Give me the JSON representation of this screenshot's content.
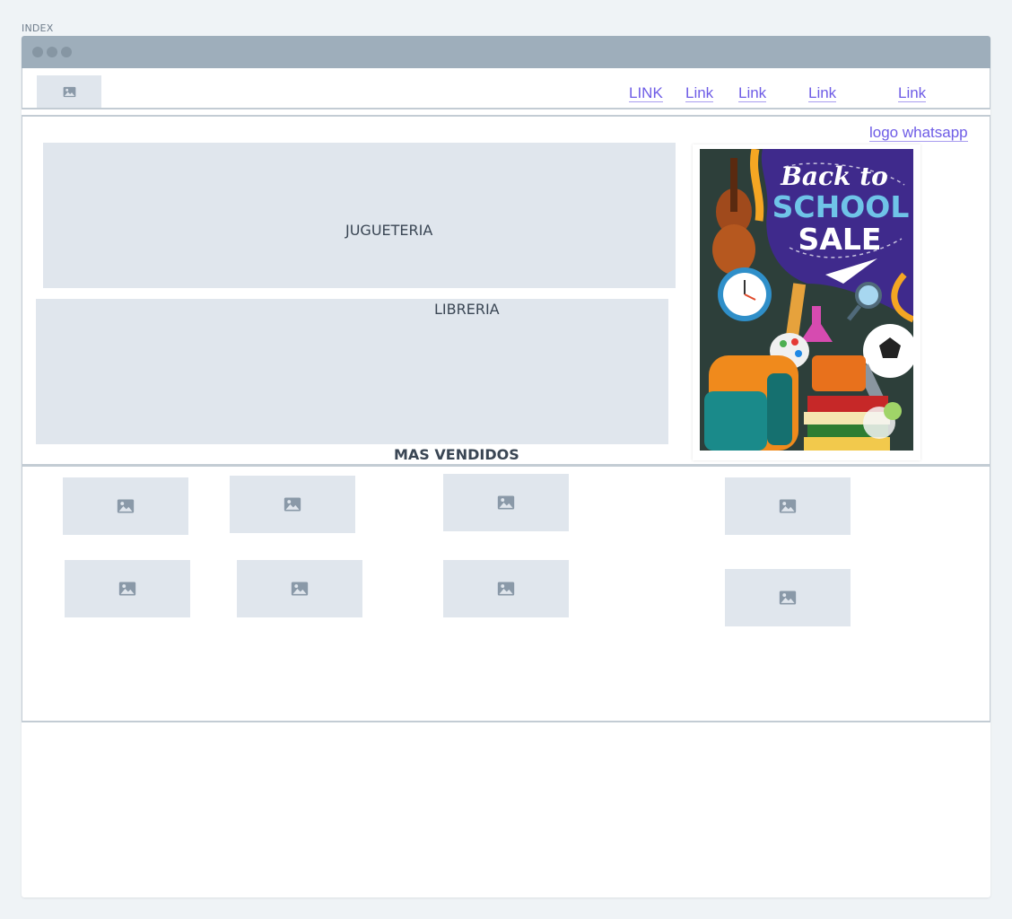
{
  "page": {
    "label": "INDEX"
  },
  "nav": {
    "links": [
      "LINK",
      "Link",
      "Link",
      "Link",
      "Link"
    ]
  },
  "hero": {
    "whatsapp_label": "logo whatsapp",
    "jugueteria_label": "JUGUETERIA",
    "libreria_label": "LIBRERIA",
    "poster": {
      "line1": "Back to",
      "line2": "SCHOOL",
      "line3": "SALE",
      "bg_color": "#3f2a8c",
      "title_color": "#6fc4e8",
      "accent_color": "#f5a623"
    }
  },
  "bestsellers": {
    "title": "MAS VENDIDOS",
    "items": [
      "image-placeholder",
      "image-placeholder",
      "image-placeholder",
      "image-placeholder",
      "image-placeholder",
      "image-placeholder",
      "image-placeholder",
      "image-placeholder"
    ]
  },
  "colors": {
    "link": "#6e5ce6",
    "placeholder": "#e0e6ed",
    "titlebar": "#9eaebb"
  }
}
